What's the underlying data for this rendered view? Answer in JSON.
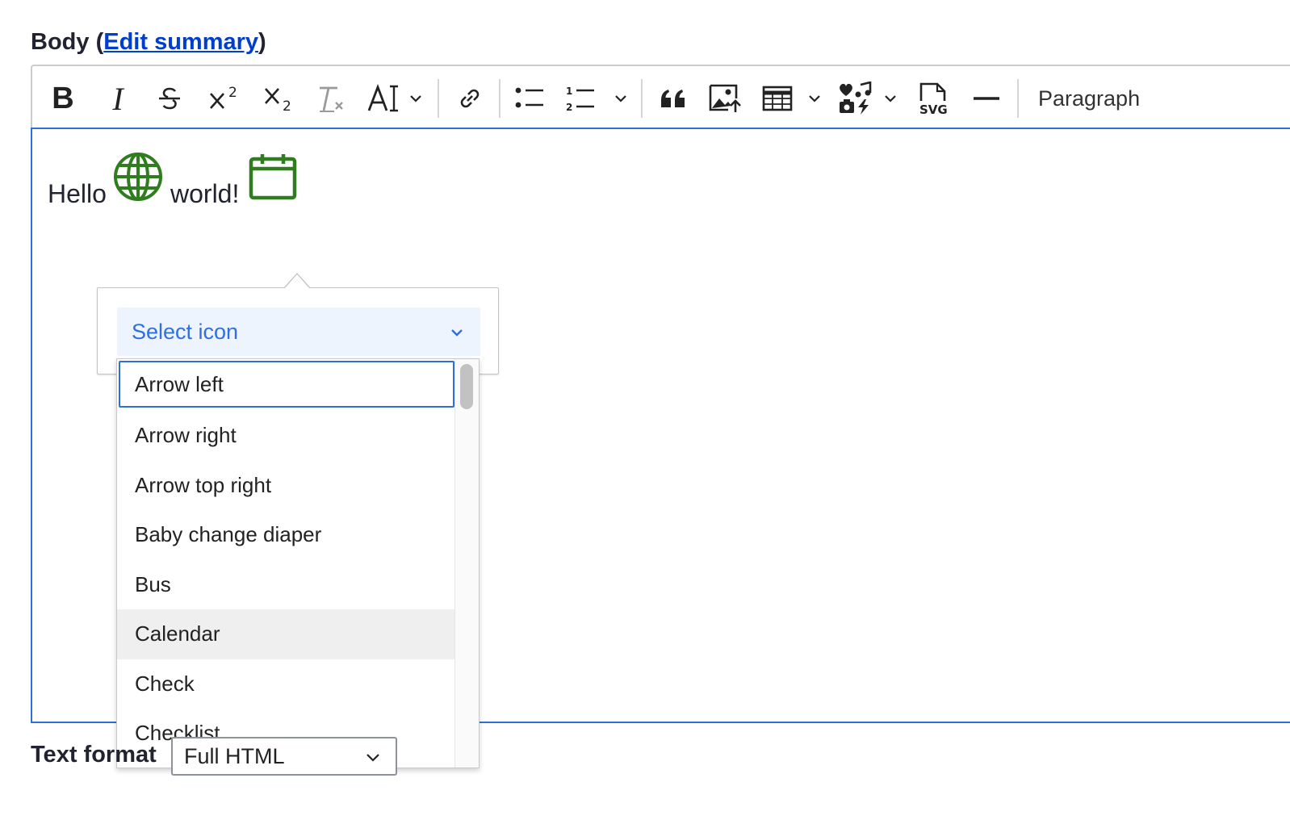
{
  "field": {
    "label": "Body",
    "open_paren": "(",
    "edit_summary_link": "Edit summary",
    "close_paren": ")"
  },
  "toolbar": {
    "bold": "B",
    "italic": "I",
    "paragraph_label": "Paragraph"
  },
  "content": {
    "word1": "Hello",
    "word2": "world!",
    "icon_color": "#2f7d1f"
  },
  "icon_picker": {
    "select_label": "Select icon",
    "options": [
      "Arrow left",
      "Arrow right",
      "Arrow top right",
      "Baby change diaper",
      "Bus",
      "Calendar",
      "Check",
      "Checklist"
    ],
    "focused_option": "Arrow left",
    "hovered_option": "Calendar"
  },
  "text_format": {
    "label": "Text format",
    "value": "Full HTML"
  },
  "colors": {
    "accent": "#2e6fd8",
    "link": "#003ecc",
    "select_text": "#2f6fe0"
  }
}
